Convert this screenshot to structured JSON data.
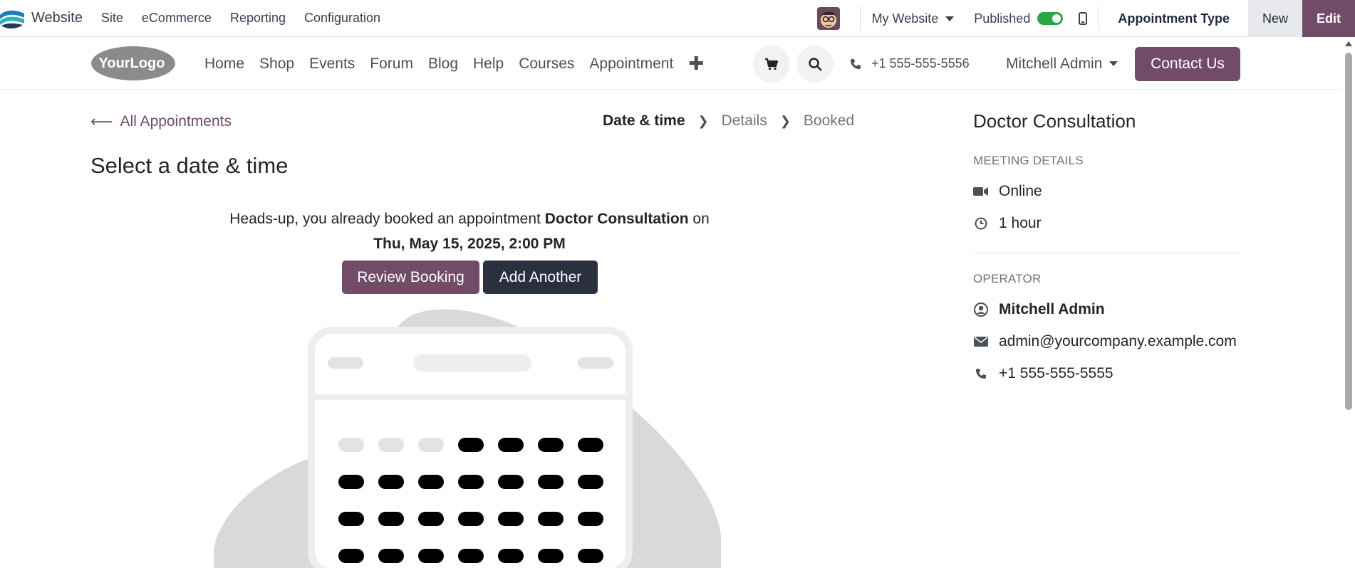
{
  "admin_bar": {
    "app_name": "Website",
    "menu": [
      "Site",
      "eCommerce",
      "Reporting",
      "Configuration"
    ],
    "website_selector": "My Website",
    "published_label": "Published",
    "published": true,
    "appointment_type_button": "Appointment Type",
    "new_button": "New",
    "edit_button": "Edit"
  },
  "header": {
    "logo_text": "YourLogo",
    "nav": [
      "Home",
      "Shop",
      "Events",
      "Forum",
      "Blog",
      "Help",
      "Courses",
      "Appointment"
    ],
    "phone": "+1 555-555-5556",
    "user": "Mitchell Admin",
    "contact_button": "Contact Us"
  },
  "main": {
    "back_link": "All Appointments",
    "steps": [
      {
        "label": "Date & time",
        "active": true
      },
      {
        "label": "Details",
        "active": false
      },
      {
        "label": "Booked",
        "active": false
      }
    ],
    "title": "Select a date & time",
    "notice_prefix": "Heads-up, you already booked an appointment",
    "notice_appointment": "Doctor Consultation",
    "notice_on": "on",
    "notice_datetime": "Thu, May 15, 2025, 2:00 PM",
    "review_button": "Review Booking",
    "add_button": "Add Another"
  },
  "sidebar": {
    "title": "Doctor Consultation",
    "meeting_label": "MEETING DETAILS",
    "location": "Online",
    "duration": "1 hour",
    "operator_label": "OPERATOR",
    "operator_name": "Mitchell Admin",
    "operator_email": "admin@yourcompany.example.com",
    "operator_phone": "+1 555-555-5555"
  },
  "colors": {
    "primary": "#714b67",
    "dark_button": "#2b3040",
    "toggle_on": "#28a745"
  },
  "icons": [
    "website-app-icon",
    "caret-down-icon",
    "mobile-icon",
    "cart-icon",
    "search-icon",
    "phone-icon",
    "arrow-left-icon",
    "chevron-right-icon",
    "video-icon",
    "clock-icon",
    "user-circle-icon",
    "envelope-icon",
    "plus-icon"
  ]
}
